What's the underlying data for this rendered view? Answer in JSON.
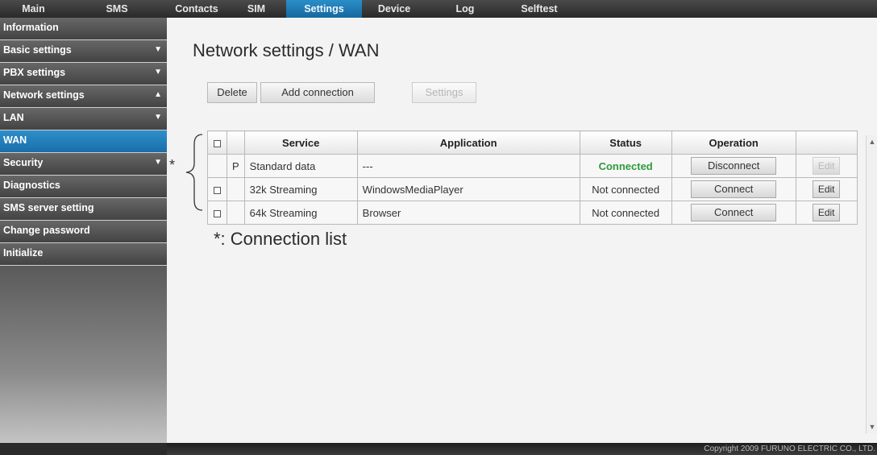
{
  "nav": {
    "tabs": [
      {
        "label": "Main"
      },
      {
        "label": "SMS"
      },
      {
        "label": "Contacts"
      },
      {
        "label": "SIM"
      },
      {
        "label": "Settings"
      },
      {
        "label": "Device"
      },
      {
        "label": "Log"
      },
      {
        "label": "Selftest"
      }
    ],
    "active": "Settings"
  },
  "sidebar": {
    "items": [
      {
        "label": "Information",
        "arrow": ""
      },
      {
        "label": "Basic settings",
        "arrow": "▼"
      },
      {
        "label": "PBX settings",
        "arrow": "▼"
      },
      {
        "label": "Network settings",
        "arrow": "▲"
      },
      {
        "label": "LAN",
        "arrow": "▼"
      },
      {
        "label": "WAN",
        "arrow": ""
      },
      {
        "label": "Security",
        "arrow": "▼"
      },
      {
        "label": "Diagnostics",
        "arrow": ""
      },
      {
        "label": "SMS server setting",
        "arrow": ""
      },
      {
        "label": "Change password",
        "arrow": ""
      },
      {
        "label": "Initialize",
        "arrow": ""
      }
    ],
    "active": "WAN"
  },
  "page": {
    "title": "Network settings / WAN",
    "toolbar": {
      "delete_label": "Delete",
      "add_label": "Add connection",
      "settings_label": "Settings"
    },
    "table": {
      "headers": {
        "service": "Service",
        "application": "Application",
        "status": "Status",
        "operation": "Operation"
      },
      "rows": [
        {
          "check": "",
          "p": "P",
          "service": "Standard data",
          "application": "---",
          "status": "Connected",
          "operation": "Disconnect",
          "edit": "Edit"
        },
        {
          "check": "☐",
          "p": "",
          "service": "32k Streaming",
          "application": "WindowsMediaPlayer",
          "status": "Not connected",
          "operation": "Connect",
          "edit": "Edit"
        },
        {
          "check": "☐",
          "p": "",
          "service": "64k Streaming",
          "application": "Browser",
          "status": "Not connected",
          "operation": "Connect",
          "edit": "Edit"
        }
      ]
    },
    "annotation_star": "*",
    "annotation_note": "*: Connection list"
  },
  "footer": {
    "copyright": "Copyright 2009 FURUNO ELECTRIC CO., LTD."
  },
  "colors": {
    "active_tab": "#1a7bb8",
    "connected": "#2e9b3c"
  }
}
